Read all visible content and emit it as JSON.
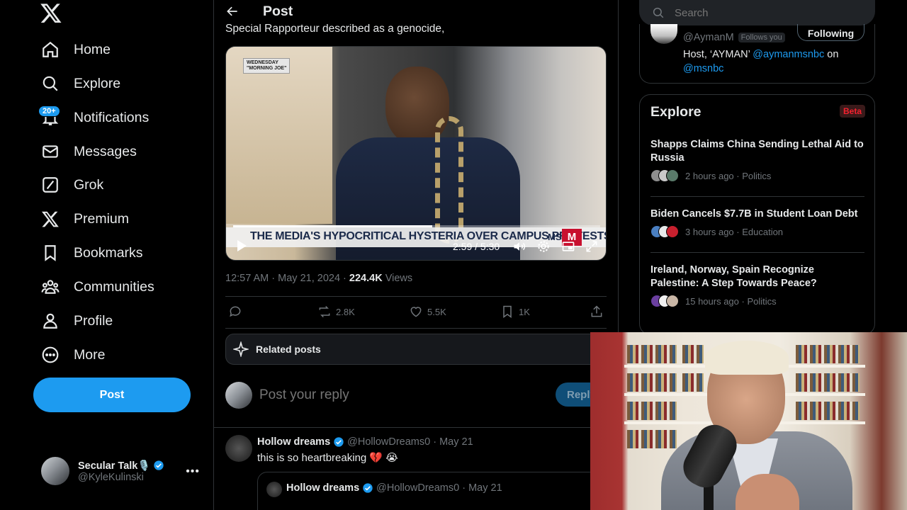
{
  "sidebar": {
    "nav": [
      {
        "label": "Home",
        "icon": "home-icon"
      },
      {
        "label": "Explore",
        "icon": "search-icon"
      },
      {
        "label": "Notifications",
        "icon": "bell-icon"
      },
      {
        "label": "Messages",
        "icon": "mail-icon"
      },
      {
        "label": "Grok",
        "icon": "grok-icon"
      },
      {
        "label": "Premium",
        "icon": "x-logo-icon"
      },
      {
        "label": "Bookmarks",
        "icon": "bookmark-icon"
      },
      {
        "label": "Communities",
        "icon": "communities-icon"
      },
      {
        "label": "Profile",
        "icon": "person-icon"
      },
      {
        "label": "More",
        "icon": "more-circle-icon"
      }
    ],
    "notifications_badge": "20+",
    "post_button": "Post",
    "account": {
      "name": "Secular Talk🎙️",
      "handle": "@KyleKulinski"
    }
  },
  "main": {
    "header_title": "Post",
    "cut_text": "Special Rapporteur described as a genocide,",
    "video": {
      "tag_line1": "WEDNESDAY",
      "tag_line2": "\"MORNING JOE\"",
      "chyron": "THE MEDIA'S HYPOCRITICAL HYSTERIA OVER CAMPUS PROTESTS",
      "network": "MS",
      "time": "2:59 / 5:30",
      "progress": 0.543
    },
    "meta": {
      "time": "12:57 AM · May 21, 2024 · ",
      "views_count": "224.4K",
      "views_label": " Views"
    },
    "actions": {
      "retweets": "2.8K",
      "likes": "5.5K",
      "bookmarks": "1K"
    },
    "related_label": "Related posts",
    "reply_placeholder": "Post your reply",
    "reply_button": "Reply",
    "reply_post": {
      "name": "Hollow dreams",
      "handle": "@HollowDreams0 · May 21",
      "text": "this is so heartbreaking 💔 😭",
      "quote_name": "Hollow dreams",
      "quote_handle": "@HollowDreams0 · May 21"
    }
  },
  "right": {
    "search_placeholder": "Search",
    "who_follow": {
      "handle": "@AymanM",
      "follows_you": "Follows you",
      "following_button": "Following",
      "bio_prefix": "Host, ‘AYMAN’ ",
      "bio_link1": "@aymanmsnbc",
      "bio_mid": " on",
      "bio_link2": "@msnbc"
    },
    "explore": {
      "title": "Explore",
      "beta": "Beta",
      "trends": [
        {
          "title": "Shapps Claims China Sending Lethal Aid to Russia",
          "meta": "2 hours ago · Politics"
        },
        {
          "title": "Biden Cancels $7.7B in Student Loan Debt",
          "meta": "3 hours ago · Education"
        },
        {
          "title": "Ireland, Norway, Spain Recognize Palestine: A Step Towards Peace?",
          "meta": "15 hours ago · Politics"
        }
      ]
    }
  },
  "colors": {
    "accent": "#1d9bf0",
    "background": "#000000",
    "muted": "#71767b",
    "border": "#2f3336",
    "beta_red": "#f4212e"
  }
}
